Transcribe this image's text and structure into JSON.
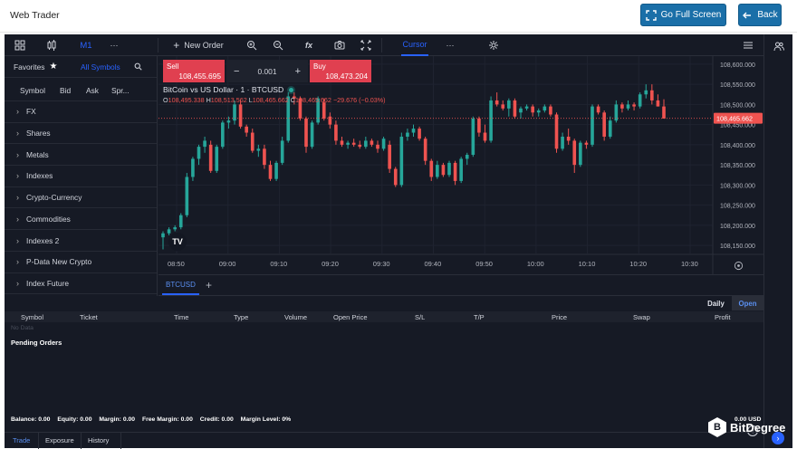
{
  "header": {
    "title": "Web Trader",
    "fullscreen_label": "Go Full Screen",
    "back_label": "Back"
  },
  "toolbar": {
    "timeframe": "M1",
    "more": "···",
    "new_order": "New Order",
    "fx": "fx",
    "cursor": "Cursor",
    "more2": "···"
  },
  "sidebar": {
    "tabs": {
      "favorites": "Favorites",
      "all_symbols": "All Symbols"
    },
    "columns": [
      "Symbol",
      "Bid",
      "Ask",
      "Spr..."
    ],
    "groups": [
      "FX",
      "Shares",
      "Metals",
      "Indexes",
      "Crypto-Currency",
      "Commodities",
      "Indexes 2",
      "P-Data New Crypto",
      "Index Future"
    ]
  },
  "trade_panel": {
    "sell_label": "Sell",
    "sell_price": "108,455.695",
    "buy_label": "Buy",
    "buy_price": "108,473.204",
    "quantity": "0.001",
    "minus": "−",
    "plus": "+"
  },
  "chart": {
    "legend_title": "BitCoin vs US Dollar · 1 · BTCUSD",
    "ohlc": {
      "o_label": "O",
      "o": "108,495.338",
      "h_label": "H",
      "h": "108,513.562",
      "l_label": "L",
      "l": "108,465.662",
      "c_label": "C",
      "c": "108,465.662",
      "change": "−29.676 (−0.03%)"
    },
    "last_price_tag": "108,465.662",
    "tab": "BTCUSD",
    "tab_add": "+",
    "colors": {
      "up": "#26a69a",
      "down": "#ef5350",
      "bg": "#161a25",
      "accent": "#2962ff"
    }
  },
  "chart_data": {
    "type": "candlestick",
    "symbol": "BTCUSD",
    "y_ticks": [
      "108,600.000",
      "108,550.000",
      "108,500.000",
      "108,450.000",
      "108,400.000",
      "108,350.000",
      "108,300.000",
      "108,250.000",
      "108,200.000",
      "108,150.000"
    ],
    "x_ticks": [
      "08:50",
      "09:00",
      "09:10",
      "09:20",
      "09:30",
      "09:40",
      "09:50",
      "10:00",
      "10:10",
      "10:20",
      "10:30"
    ],
    "ylim": [
      108130,
      108620
    ],
    "last_price": 108465.662,
    "candles": [
      {
        "o": 108170,
        "h": 108185,
        "l": 108140,
        "c": 108180
      },
      {
        "o": 108180,
        "h": 108195,
        "l": 108175,
        "c": 108190
      },
      {
        "o": 108190,
        "h": 108200,
        "l": 108185,
        "c": 108195
      },
      {
        "o": 108195,
        "h": 108230,
        "l": 108190,
        "c": 108225
      },
      {
        "o": 108225,
        "h": 108330,
        "l": 108220,
        "c": 108320
      },
      {
        "o": 108320,
        "h": 108370,
        "l": 108310,
        "c": 108365
      },
      {
        "o": 108365,
        "h": 108400,
        "l": 108350,
        "c": 108395
      },
      {
        "o": 108395,
        "h": 108420,
        "l": 108380,
        "c": 108410
      },
      {
        "o": 108400,
        "h": 108410,
        "l": 108330,
        "c": 108335
      },
      {
        "o": 108335,
        "h": 108400,
        "l": 108330,
        "c": 108395
      },
      {
        "o": 108395,
        "h": 108460,
        "l": 108390,
        "c": 108455
      },
      {
        "o": 108455,
        "h": 108470,
        "l": 108440,
        "c": 108460
      },
      {
        "o": 108460,
        "h": 108510,
        "l": 108450,
        "c": 108500
      },
      {
        "o": 108500,
        "h": 108510,
        "l": 108440,
        "c": 108445
      },
      {
        "o": 108445,
        "h": 108450,
        "l": 108420,
        "c": 108430
      },
      {
        "o": 108430,
        "h": 108440,
        "l": 108380,
        "c": 108385
      },
      {
        "o": 108385,
        "h": 108400,
        "l": 108370,
        "c": 108390
      },
      {
        "o": 108390,
        "h": 108400,
        "l": 108340,
        "c": 108350
      },
      {
        "o": 108350,
        "h": 108360,
        "l": 108310,
        "c": 108315
      },
      {
        "o": 108315,
        "h": 108360,
        "l": 108310,
        "c": 108355
      },
      {
        "o": 108355,
        "h": 108420,
        "l": 108350,
        "c": 108410
      },
      {
        "o": 108410,
        "h": 108530,
        "l": 108405,
        "c": 108520
      },
      {
        "o": 108520,
        "h": 108530,
        "l": 108500,
        "c": 108515
      },
      {
        "o": 108515,
        "h": 108520,
        "l": 108460,
        "c": 108465
      },
      {
        "o": 108465,
        "h": 108470,
        "l": 108380,
        "c": 108395
      },
      {
        "o": 108395,
        "h": 108460,
        "l": 108390,
        "c": 108455
      },
      {
        "o": 108455,
        "h": 108520,
        "l": 108450,
        "c": 108515
      },
      {
        "o": 108505,
        "h": 108515,
        "l": 108460,
        "c": 108465
      },
      {
        "o": 108470,
        "h": 108480,
        "l": 108440,
        "c": 108450
      },
      {
        "o": 108450,
        "h": 108460,
        "l": 108400,
        "c": 108410
      },
      {
        "o": 108410,
        "h": 108420,
        "l": 108395,
        "c": 108400
      },
      {
        "o": 108400,
        "h": 108410,
        "l": 108390,
        "c": 108405
      },
      {
        "o": 108405,
        "h": 108415,
        "l": 108395,
        "c": 108400
      },
      {
        "o": 108400,
        "h": 108410,
        "l": 108390,
        "c": 108395
      },
      {
        "o": 108395,
        "h": 108420,
        "l": 108390,
        "c": 108410
      },
      {
        "o": 108410,
        "h": 108415,
        "l": 108395,
        "c": 108400
      },
      {
        "o": 108400,
        "h": 108410,
        "l": 108380,
        "c": 108390
      },
      {
        "o": 108390,
        "h": 108420,
        "l": 108385,
        "c": 108415
      },
      {
        "o": 108400,
        "h": 108410,
        "l": 108330,
        "c": 108340
      },
      {
        "o": 108340,
        "h": 108345,
        "l": 108295,
        "c": 108300
      },
      {
        "o": 108300,
        "h": 108430,
        "l": 108295,
        "c": 108420
      },
      {
        "o": 108420,
        "h": 108440,
        "l": 108410,
        "c": 108430
      },
      {
        "o": 108430,
        "h": 108450,
        "l": 108420,
        "c": 108440
      },
      {
        "o": 108440,
        "h": 108445,
        "l": 108410,
        "c": 108415
      },
      {
        "o": 108415,
        "h": 108420,
        "l": 108350,
        "c": 108360
      },
      {
        "o": 108360,
        "h": 108365,
        "l": 108310,
        "c": 108320
      },
      {
        "o": 108320,
        "h": 108360,
        "l": 108315,
        "c": 108350
      },
      {
        "o": 108350,
        "h": 108355,
        "l": 108320,
        "c": 108325
      },
      {
        "o": 108325,
        "h": 108360,
        "l": 108320,
        "c": 108355
      },
      {
        "o": 108355,
        "h": 108360,
        "l": 108300,
        "c": 108310
      },
      {
        "o": 108310,
        "h": 108370,
        "l": 108305,
        "c": 108365
      },
      {
        "o": 108365,
        "h": 108380,
        "l": 108350,
        "c": 108375
      },
      {
        "o": 108375,
        "h": 108470,
        "l": 108370,
        "c": 108465
      },
      {
        "o": 108465,
        "h": 108470,
        "l": 108420,
        "c": 108430
      },
      {
        "o": 108430,
        "h": 108450,
        "l": 108405,
        "c": 108410
      },
      {
        "o": 108410,
        "h": 108520,
        "l": 108405,
        "c": 108510
      },
      {
        "o": 108510,
        "h": 108530,
        "l": 108495,
        "c": 108500
      },
      {
        "o": 108500,
        "h": 108510,
        "l": 108485,
        "c": 108490
      },
      {
        "o": 108490,
        "h": 108515,
        "l": 108470,
        "c": 108510
      },
      {
        "o": 108510,
        "h": 108515,
        "l": 108465,
        "c": 108470
      },
      {
        "o": 108480,
        "h": 108495,
        "l": 108465,
        "c": 108490
      },
      {
        "o": 108490,
        "h": 108500,
        "l": 108485,
        "c": 108495
      },
      {
        "o": 108495,
        "h": 108500,
        "l": 108470,
        "c": 108480
      },
      {
        "o": 108480,
        "h": 108490,
        "l": 108470,
        "c": 108485
      },
      {
        "o": 108485,
        "h": 108500,
        "l": 108480,
        "c": 108495
      },
      {
        "o": 108495,
        "h": 108500,
        "l": 108470,
        "c": 108475
      },
      {
        "o": 108475,
        "h": 108480,
        "l": 108380,
        "c": 108390
      },
      {
        "o": 108390,
        "h": 108430,
        "l": 108385,
        "c": 108420
      },
      {
        "o": 108420,
        "h": 108440,
        "l": 108400,
        "c": 108410
      },
      {
        "o": 108410,
        "h": 108415,
        "l": 108330,
        "c": 108350
      },
      {
        "o": 108350,
        "h": 108410,
        "l": 108345,
        "c": 108405
      },
      {
        "o": 108405,
        "h": 108410,
        "l": 108390,
        "c": 108400
      },
      {
        "o": 108400,
        "h": 108500,
        "l": 108395,
        "c": 108495
      },
      {
        "o": 108495,
        "h": 108500,
        "l": 108475,
        "c": 108480
      },
      {
        "o": 108480,
        "h": 108485,
        "l": 108410,
        "c": 108420
      },
      {
        "o": 108420,
        "h": 108470,
        "l": 108415,
        "c": 108460
      },
      {
        "o": 108460,
        "h": 108510,
        "l": 108455,
        "c": 108500
      },
      {
        "o": 108500,
        "h": 108505,
        "l": 108480,
        "c": 108490
      },
      {
        "o": 108490,
        "h": 108510,
        "l": 108485,
        "c": 108500
      },
      {
        "o": 108500,
        "h": 108505,
        "l": 108485,
        "c": 108495
      },
      {
        "o": 108495,
        "h": 108530,
        "l": 108490,
        "c": 108525
      },
      {
        "o": 108525,
        "h": 108550,
        "l": 108515,
        "c": 108535
      },
      {
        "o": 108535,
        "h": 108550,
        "l": 108500,
        "c": 108510
      },
      {
        "o": 108510,
        "h": 108525,
        "l": 108495,
        "c": 108495
      },
      {
        "o": 108495,
        "h": 108513,
        "l": 108465,
        "c": 108465
      }
    ]
  },
  "orders": {
    "view_tabs": [
      "Daily",
      "Open"
    ],
    "columns": [
      "Symbol",
      "Ticket",
      "Time",
      "Type",
      "Volume",
      "Open Price",
      "S/L",
      "T/P",
      "Price",
      "Swap",
      "Profit"
    ],
    "no_data": "No Data",
    "pending_title": "Pending Orders"
  },
  "account": {
    "balance": "Balance: 0.00",
    "equity": "Equity: 0.00",
    "margin": "Margin: 0.00",
    "free_margin": "Free Margin: 0.00",
    "credit": "Credit: 0.00",
    "margin_level": "Margin Level: 0%",
    "total": "0.00 USD"
  },
  "bottom_tabs": [
    "Trade",
    "Exposure",
    "History"
  ],
  "watermark": {
    "text": "BitDegree",
    "logo_letter": "B"
  }
}
